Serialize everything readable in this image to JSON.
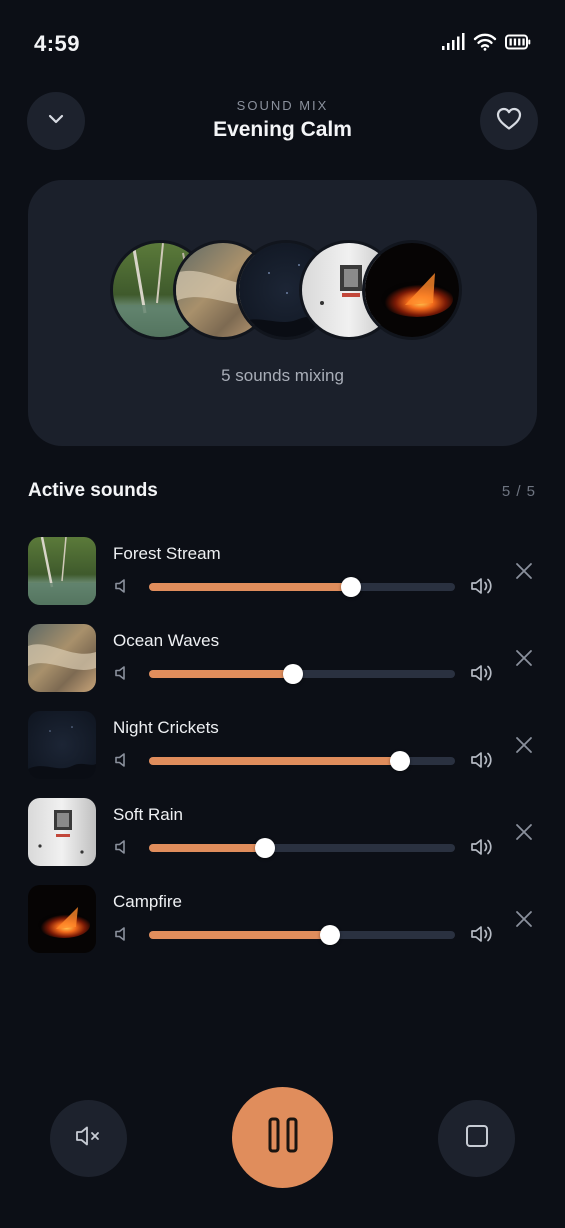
{
  "status_bar": {
    "time": "4:59",
    "icons": [
      "cellular-signal-icon",
      "wifi-icon",
      "battery-icon"
    ]
  },
  "header": {
    "kicker": "SOUND MIX",
    "title": "Evening Calm",
    "left_icon": "chevron-down-icon",
    "right_icon": "heart-icon"
  },
  "hero": {
    "count_text": "5 sounds mixing"
  },
  "active": {
    "title": "Active sounds",
    "count": "5 / 5"
  },
  "sounds": [
    {
      "name": "Forest Stream",
      "volume": 0.66
    },
    {
      "name": "Ocean Waves",
      "volume": 0.47
    },
    {
      "name": "Night Crickets",
      "volume": 0.82
    },
    {
      "name": "Soft Rain",
      "volume": 0.38
    },
    {
      "name": "Campfire",
      "volume": 0.59
    }
  ],
  "controls": {
    "mute_icon": "mute-icon",
    "play_icon": "pause-icon",
    "stop_icon": "stop-icon"
  },
  "colors": {
    "background": "#0c0f16",
    "card": "#1b202b",
    "accent": "#e08d5c",
    "track": "#2a3140"
  }
}
